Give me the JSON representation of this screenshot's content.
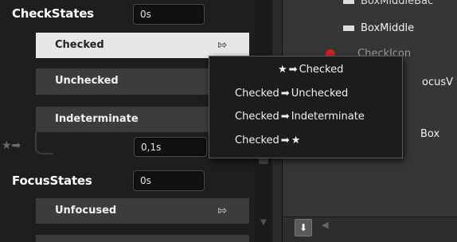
{
  "check_states": {
    "group_label": "CheckStates",
    "time": "0s",
    "items": [
      {
        "label": "Checked",
        "selected": true
      },
      {
        "label": "Unchecked",
        "selected": false
      },
      {
        "label": "Indeterminate",
        "selected": false
      }
    ],
    "transition_glyph": "★➡",
    "transition_time": "0,1s"
  },
  "focus_states": {
    "group_label": "FocusStates",
    "time": "0s",
    "items": [
      {
        "label": "Unfocused",
        "selected": false
      }
    ]
  },
  "tree": {
    "partial_top": "BoxMiddleBac",
    "box_middle": "BoxMiddle",
    "partial_checkicon": "CheckIcon",
    "partial_focus": "ocusV",
    "partial_box": "Box"
  },
  "popup_menu": {
    "items": [
      {
        "from": "★",
        "arrow": "➡",
        "to": "Checked"
      },
      {
        "from": "Checked",
        "arrow": "➡",
        "to": "Unchecked"
      },
      {
        "from": "Checked",
        "arrow": "➡",
        "to": "Indeterminate"
      },
      {
        "from": "Checked",
        "arrow": "➡",
        "to": "★"
      }
    ]
  },
  "icons": {
    "transition_add": "⇰",
    "down_arrow": "⬇",
    "prev_arrow": "◀",
    "scroll_down": "▼"
  },
  "colors": {
    "selected_bg": "#e7e7e7",
    "item_bg": "#3c3c3c",
    "panel_bg": "#1e1e1e",
    "error": "#d02020"
  }
}
